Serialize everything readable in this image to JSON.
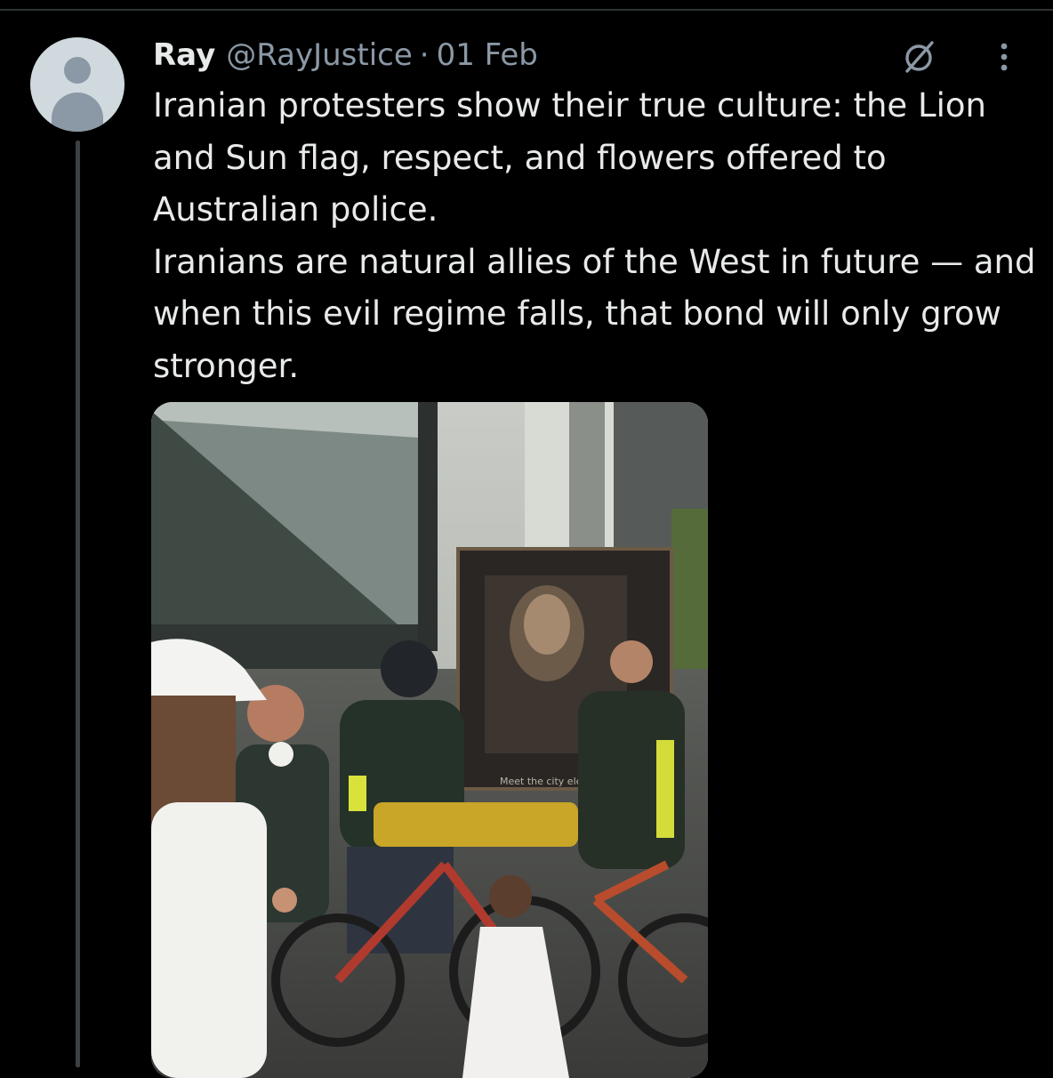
{
  "tweet": {
    "author_name": "Ray",
    "handle": "@RayJustice",
    "separator": "·",
    "date": "01 Feb",
    "text_lines": [
      "Iranian protesters show their true culture: the Lion and Sun flag, respect, and flowers offered to Australian police.",
      "Iranians are natural allies of the West in future — and when this evil regime falls, that bond will only grow stronger."
    ],
    "media": {
      "sign_text": "Meet the city electic"
    }
  },
  "icons": {
    "grok": "grok-icon",
    "more": "more-options-icon",
    "avatar": "default-avatar-icon"
  },
  "colors": {
    "background": "#000000",
    "text_primary": "#e7e9ea",
    "text_secondary": "#8b98a5",
    "divider": "#2f3336"
  }
}
